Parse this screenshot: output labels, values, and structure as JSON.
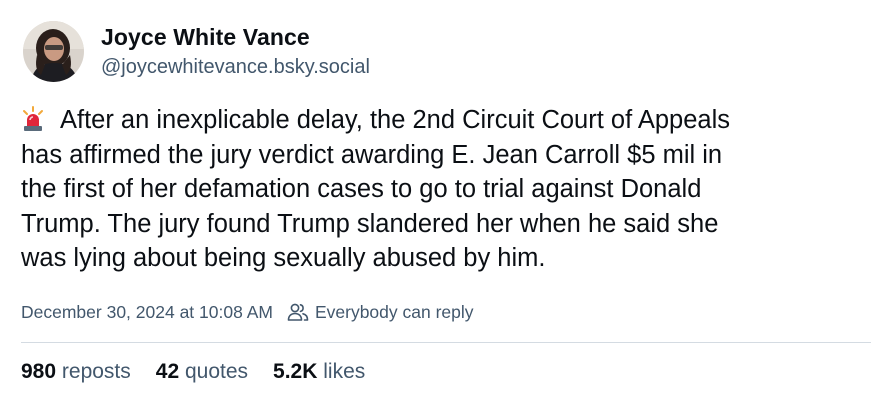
{
  "author": {
    "display_name": "Joyce White Vance",
    "handle": "@joycewhitevance.bsky.social",
    "avatar_icon": "profile-photo"
  },
  "post": {
    "leading_icon": "police-siren-emoji",
    "lines": [
      "After an inexplicable delay, the 2nd Circuit Court of Appeals",
      "has affirmed the jury verdict awarding E. Jean Carroll $5 mil in",
      "the first of her defamation cases to go to trial against Donald",
      "Trump. The jury found Trump slandered her when he said she",
      "was lying about being sexually abused by him."
    ]
  },
  "meta": {
    "timestamp": "December 30, 2024 at 10:08 AM",
    "reply_setting": "Everybody can reply",
    "reply_icon": "people-icon"
  },
  "stats": {
    "reposts_count": "980",
    "reposts_label": "reposts",
    "quotes_count": "42",
    "quotes_label": "quotes",
    "likes_count": "5.2K",
    "likes_label": "likes"
  },
  "colors": {
    "text_primary": "#0b0f14",
    "text_secondary": "#42576c",
    "divider": "#d4dbe2",
    "siren_red": "#e0263a"
  }
}
